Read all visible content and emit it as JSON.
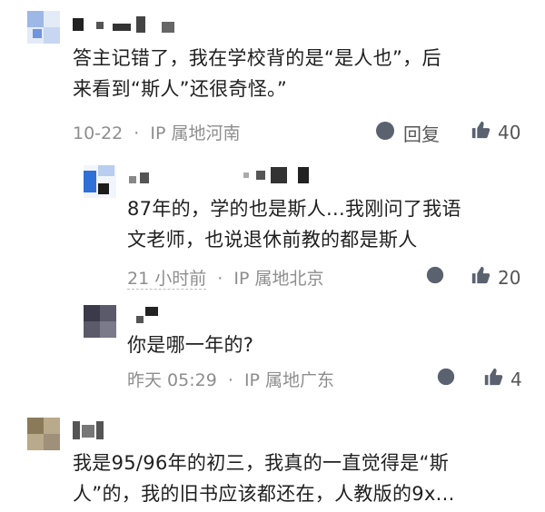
{
  "comments": [
    {
      "text_lines": [
        "答主记错了，我在学校背的是“是人也”，后",
        "来看到“斯人”还很奇怪。”"
      ],
      "time": "10-22",
      "ip": "IP 属地河南",
      "reply_label": "回复",
      "likes": "40",
      "replies": [
        {
          "text_lines": [
            "87年的，学的也是斯人...我刚问了我语",
            "文老师，也说退休前教的都是斯人"
          ],
          "time": "21 小时前",
          "ip": "IP 属地北京",
          "likes": "20"
        },
        {
          "text_lines": [
            "你是哪一年的?"
          ],
          "time": "昨天 05:29",
          "ip": "IP 属地广东",
          "likes": "4"
        }
      ]
    },
    {
      "text_lines": [
        "我是95/96年的初三，我真的一直觉得是“斯",
        "人”的，我的旧书应该都还在，人教版的9x..."
      ]
    }
  ],
  "sep": "·",
  "colors": {
    "avatar1": "#4b7fd6",
    "avatar2": "#2f6fd8",
    "avatar3": "#3a3a4a",
    "avatar4": "#8a7a5a",
    "icon": "#5a6270"
  },
  "icons": [
    "reply-bubble-icon",
    "thumbs-up-icon"
  ]
}
